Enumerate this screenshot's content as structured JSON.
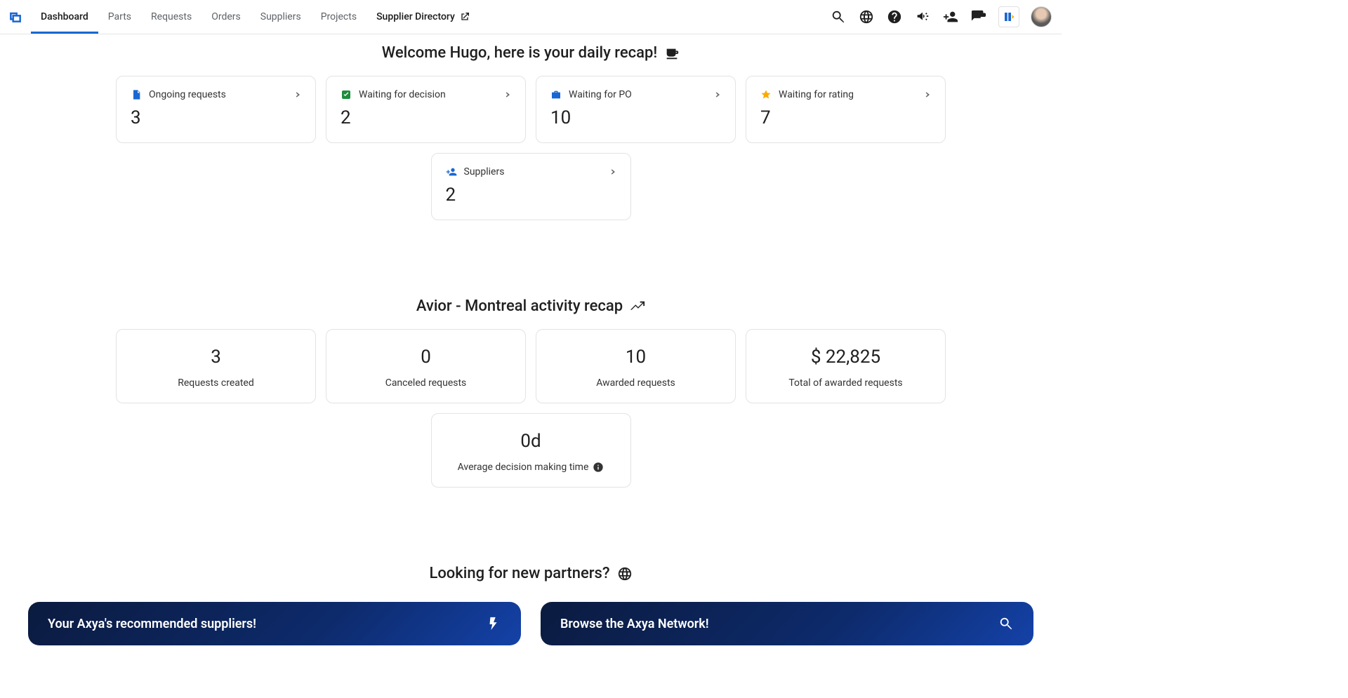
{
  "nav": {
    "tabs": [
      {
        "label": "Dashboard",
        "active": true
      },
      {
        "label": "Parts"
      },
      {
        "label": "Requests"
      },
      {
        "label": "Orders"
      },
      {
        "label": "Suppliers"
      },
      {
        "label": "Projects"
      },
      {
        "label": "Supplier Directory",
        "external": true,
        "strong": true
      }
    ]
  },
  "daily_recap": {
    "title": "Welcome Hugo, here is your daily recap!",
    "cards": [
      {
        "label": "Ongoing requests",
        "value": "3",
        "icon": "document",
        "icon_color": "#1967d2"
      },
      {
        "label": "Waiting for decision",
        "value": "2",
        "icon": "check-badge",
        "icon_color": "#1e8e3e"
      },
      {
        "label": "Waiting for PO",
        "value": "10",
        "icon": "briefcase",
        "icon_color": "#1967d2"
      },
      {
        "label": "Waiting for rating",
        "value": "7",
        "icon": "star",
        "icon_color": "#f9ab00"
      },
      {
        "label": "Suppliers",
        "value": "2",
        "icon": "person-add",
        "icon_color": "#1967d2"
      }
    ]
  },
  "activity_recap": {
    "title": "Avior - Montreal activity recap",
    "cards": [
      {
        "value": "3",
        "label": "Requests created"
      },
      {
        "value": "0",
        "label": "Canceled requests"
      },
      {
        "value": "10",
        "label": "Awarded requests"
      },
      {
        "value": "$ 22,825",
        "label": "Total of awarded requests"
      },
      {
        "value": "0d",
        "label": "Average decision making time",
        "info": true
      }
    ]
  },
  "partners": {
    "title": "Looking for new partners?",
    "cards": [
      {
        "title": "Your Axya's recommended suppliers!",
        "icon": "bolt"
      },
      {
        "title": "Browse the Axya Network!",
        "icon": "search"
      }
    ]
  }
}
